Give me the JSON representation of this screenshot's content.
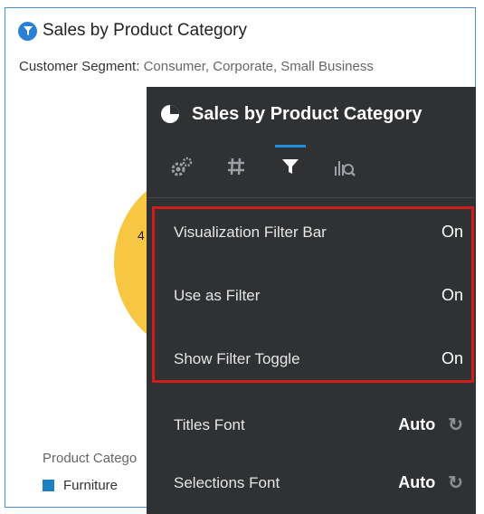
{
  "chart": {
    "title": "Sales by Product Category",
    "segment_label": "Customer Segment:",
    "segment_value": "Consumer, Corporate, Small Business",
    "pie_label_partial": "4",
    "legend_title": "Product Catego",
    "legend_items": [
      "Furniture"
    ]
  },
  "panel": {
    "title": "Sales by Product Category",
    "tabs": [
      "gears-icon",
      "hash-icon",
      "filter-icon",
      "chart-settings-icon"
    ],
    "active_tab": "filter-icon",
    "rows": [
      {
        "label": "Visualization Filter Bar",
        "value": "On"
      },
      {
        "label": "Use as Filter",
        "value": "On"
      },
      {
        "label": "Show Filter Toggle",
        "value": "On"
      },
      {
        "label": "Titles Font",
        "value": "Auto"
      },
      {
        "label": "Selections Font",
        "value": "Auto"
      }
    ]
  },
  "colors": {
    "accent": "#1e8fe3",
    "panel_bg": "#2f3133",
    "highlight": "#d11c1c",
    "pie_slice": "#f7c744"
  }
}
